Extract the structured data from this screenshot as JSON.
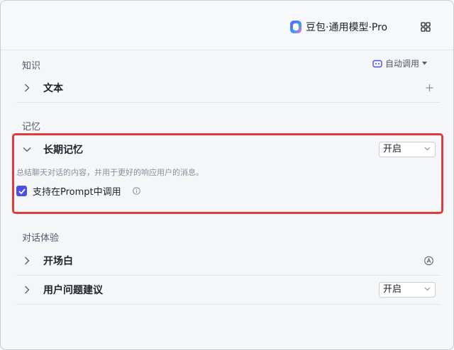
{
  "header": {
    "model_name": "豆包·通用模型·Pro",
    "model_icon": "doubao-logo-icon",
    "apps_icon": "apps-grid-icon"
  },
  "knowledge": {
    "title": "知识",
    "auto_label": "自动调用",
    "items": [
      {
        "label": "文本",
        "action_icon": "plus-icon"
      }
    ]
  },
  "memory": {
    "title": "记忆",
    "long_term": {
      "label": "长期记忆",
      "select_value": "开启",
      "description": "总结聊天对话的内容，并用于更好的响应用户的消息。",
      "checkbox_label": "支持在Prompt中调用",
      "checkbox_checked": true
    }
  },
  "experience": {
    "title": "对话体验",
    "items": [
      {
        "label": "开场白",
        "action_icon": "auto-a-icon"
      },
      {
        "label": "用户问题建议",
        "select_value": "开启"
      }
    ]
  },
  "colors": {
    "accent": "#4c4ee8",
    "highlight": "#e03a3a",
    "divider": "#e5e6eb"
  }
}
